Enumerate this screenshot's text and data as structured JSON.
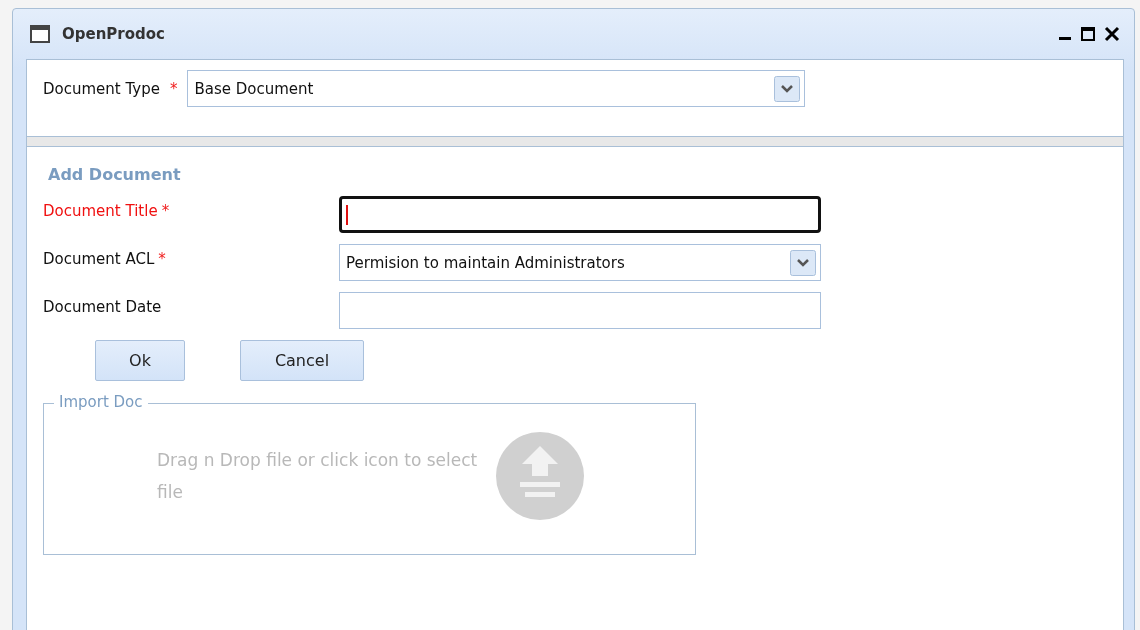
{
  "window": {
    "title": "OpenProdoc"
  },
  "type_selector": {
    "label": "Document Type",
    "required_mark": "*",
    "value": "Base Document"
  },
  "form": {
    "heading": "Add Document",
    "fields": [
      {
        "kind": "text",
        "label": "Document Title",
        "required_mark": "*",
        "invalid": true,
        "focused": true
      },
      {
        "kind": "select",
        "label": "Document ACL",
        "required_mark": "*",
        "invalid": false,
        "focused": false,
        "value": "Permision to maintain Administrators"
      },
      {
        "kind": "text",
        "label": "Document Date",
        "invalid": false,
        "focused": false
      }
    ],
    "buttons": [
      "Ok",
      "Cancel"
    ]
  },
  "import": {
    "legend": "Import Doc",
    "hint": "Drag n Drop file or click icon to select file"
  }
}
